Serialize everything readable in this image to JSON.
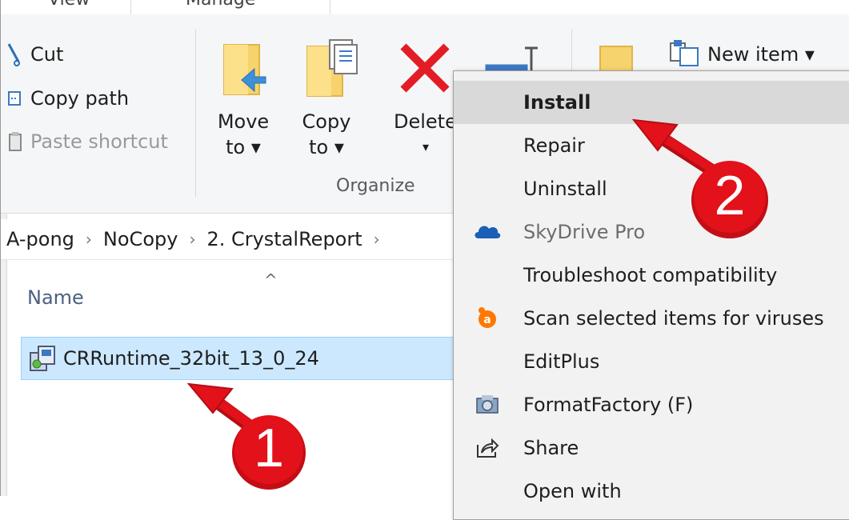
{
  "ribbon": {
    "tabs": [
      "View",
      "Manage"
    ],
    "clipboard": {
      "cut": "Cut",
      "copy_path": "Copy path",
      "paste_shortcut": "Paste shortcut"
    },
    "organize": {
      "move_to_line1": "Move",
      "move_to_line2": "to ▾",
      "copy_to_line1": "Copy",
      "copy_to_line2": "to ▾",
      "delete_line1": "Delete",
      "delete_line2": "▾",
      "group_label": "Organize"
    },
    "new_group": {
      "new_item": "New item ▾"
    }
  },
  "address_bar": {
    "segments": [
      "A-pong",
      "NoCopy",
      "2. CrystalReport"
    ],
    "separator": "›"
  },
  "file_list": {
    "column_name": "Name",
    "sort_indicator": "^",
    "files": [
      {
        "name": "CRRuntime_32bit_13_0_24",
        "selected": true
      }
    ]
  },
  "context_menu": {
    "items": [
      {
        "label": "Install",
        "default": true,
        "highlighted": true,
        "icon": ""
      },
      {
        "label": "Repair",
        "icon": ""
      },
      {
        "label": "Uninstall",
        "icon": ""
      },
      {
        "label": "SkyDrive Pro",
        "disabled": true,
        "icon": "skydrive-icon"
      },
      {
        "label": "Troubleshoot compatibility",
        "icon": ""
      },
      {
        "label": "Scan selected items for viruses",
        "icon": "avast-icon"
      },
      {
        "label": "EditPlus",
        "icon": ""
      },
      {
        "label": "FormatFactory (F)",
        "icon": "formatfactory-icon"
      },
      {
        "label": "Share",
        "icon": "share-icon"
      },
      {
        "label": "Open with",
        "icon": ""
      }
    ]
  },
  "annotations": {
    "step1": "1",
    "step2": "2"
  },
  "colors": {
    "selection_bg": "#cce8ff",
    "menu_bg": "#f2f2f2",
    "menu_highlight": "#d9d9d9",
    "annotation_red": "#e3111a"
  }
}
